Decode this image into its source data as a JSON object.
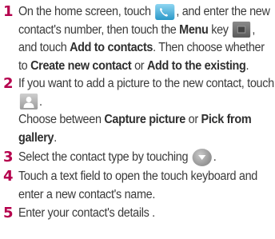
{
  "colors": {
    "step_number": "#b5004d",
    "text": "#3a3a3a"
  },
  "steps": [
    {
      "number": "1",
      "t1": "On the home screen, touch",
      "t2": ", and enter the new contact's number, then touch the",
      "menu_key": "Menu",
      "t3": "key",
      "t4": ", and touch",
      "add_to_contacts": "Add to contacts",
      "t5": ". Then choose whether to",
      "create_new_contact": "Create new contact",
      "t6": "or",
      "add_to_existing": "Add to the existing",
      "t7": ".",
      "icons": [
        "phone-icon",
        "menu-key-icon"
      ]
    },
    {
      "number": "2",
      "t1": "If you want to add a picture to the new contact, touch",
      "t2": ".",
      "t3": "Choose between",
      "capture_picture": "Capture picture",
      "t4": "or",
      "pick_from_gallery": "Pick from gallery",
      "t5": ".",
      "icons": [
        "contact-picture-icon"
      ]
    },
    {
      "number": "3",
      "t1": "Select the contact type by touching",
      "t2": ".",
      "icons": [
        "dropdown-arrow-icon"
      ]
    },
    {
      "number": "4",
      "t1": "Touch a text field to open the touch keyboard and enter a new contact's name."
    },
    {
      "number": "5",
      "t1": "Enter your contact's details ."
    }
  ]
}
